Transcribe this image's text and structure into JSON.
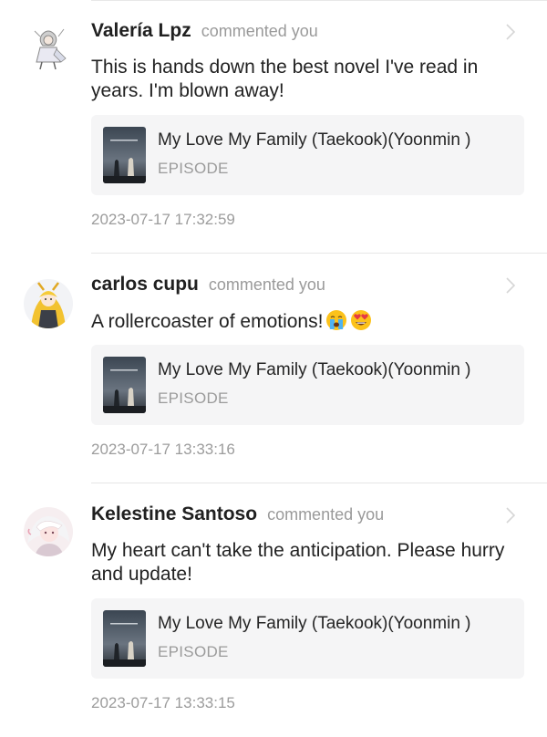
{
  "notifications": [
    {
      "user": "Valería Lpz",
      "action": "commented you",
      "comment": "This is hands down the best novel I've read in years. I'm blown away!",
      "emojis": [],
      "book_title": "My Love My Family (Taekook)(Yoonmin )",
      "book_sub": "EPISODE",
      "timestamp": "2023-07-17 17:32:59"
    },
    {
      "user": "carlos cupu",
      "action": "commented you",
      "comment": "A rollercoaster of emotions!",
      "emojis": [
        "crying-face",
        "heart-eyes-face"
      ],
      "book_title": "My Love My Family (Taekook)(Yoonmin )",
      "book_sub": "EPISODE",
      "timestamp": "2023-07-17 13:33:16"
    },
    {
      "user": "Kelestine Santoso",
      "action": "commented you",
      "comment": "My heart can't take the anticipation. Please hurry and update!",
      "emojis": [],
      "book_title": "My Love My Family (Taekook)(Yoonmin )",
      "book_sub": "EPISODE",
      "timestamp": "2023-07-17 13:33:15"
    }
  ]
}
